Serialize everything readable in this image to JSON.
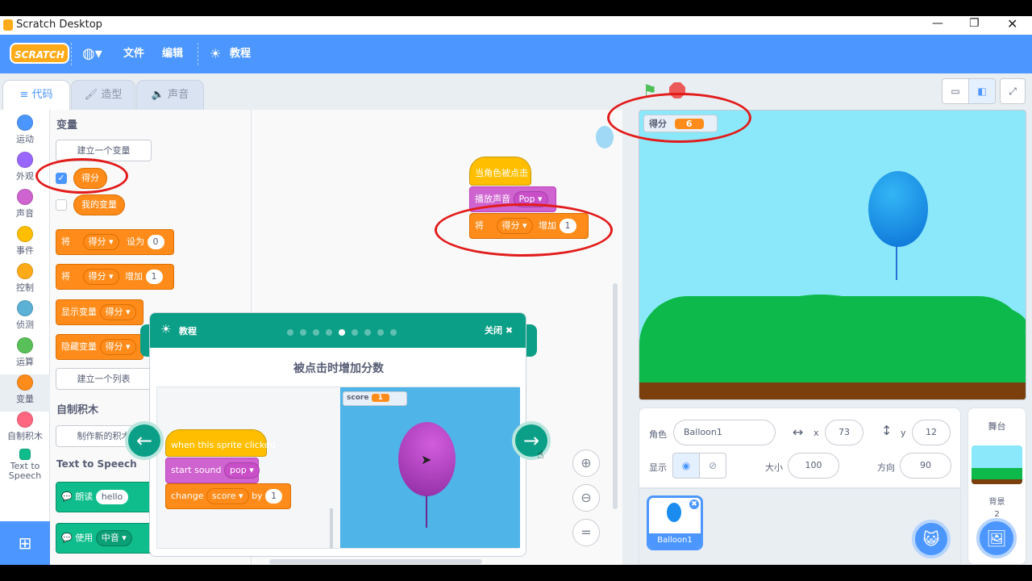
{
  "window": {
    "title": "Scratch Desktop"
  },
  "menubar": {
    "logo": "SCRATCH",
    "file": "文件",
    "edit": "编辑",
    "tutorials": "教程"
  },
  "tabs": {
    "code": "代码",
    "costumes": "造型",
    "sounds": "声音"
  },
  "categories": [
    {
      "label": "运动",
      "color": "#4c97ff"
    },
    {
      "label": "外观",
      "color": "#9966ff"
    },
    {
      "label": "声音",
      "color": "#cf63cf"
    },
    {
      "label": "事件",
      "color": "#ffbf00"
    },
    {
      "label": "控制",
      "color": "#ffab19"
    },
    {
      "label": "侦测",
      "color": "#5cb1d6"
    },
    {
      "label": "运算",
      "color": "#59c059"
    },
    {
      "label": "变量",
      "color": "#ff8c1a"
    },
    {
      "label": "自制积木",
      "color": "#ff6680"
    },
    {
      "label": "Text to Speech",
      "color": "#0fbd8c"
    }
  ],
  "palette": {
    "variables_heading": "变量",
    "make_variable": "建立一个变量",
    "var_score": "得分",
    "var_mine": "我的变量",
    "set_block": {
      "prefix": "将",
      "var": "得分",
      "mid": "设为",
      "value": "0"
    },
    "change_block": {
      "prefix": "将",
      "var": "得分",
      "mid": "增加",
      "value": "1"
    },
    "show_var": {
      "label": "显示变量",
      "var": "得分"
    },
    "hide_var": {
      "label": "隐藏变量",
      "var": "得分"
    },
    "make_list": "建立一个列表",
    "my_blocks_heading": "自制积木",
    "make_block": "制作新的积木",
    "tts_heading": "Text to Speech",
    "speak": {
      "label": "朗读",
      "value": "hello"
    },
    "use": {
      "label": "使用",
      "value": "中音"
    }
  },
  "script": {
    "hat": "当角色被点击",
    "sound": {
      "label": "播放声音",
      "value": "Pop"
    },
    "change": {
      "prefix": "将",
      "var": "得分",
      "mid": "增加",
      "value": "1"
    }
  },
  "tutorial": {
    "header": "教程",
    "close": "关闭",
    "title": "被点击时增加分数",
    "dots_total": 9,
    "dots_active": 5,
    "demo_hat": "when this sprite clicked",
    "demo_sound": {
      "label": "start sound",
      "value": "pop"
    },
    "demo_change": {
      "prefix": "change",
      "var": "score",
      "mid": "by",
      "value": "1"
    },
    "demo_monitor": {
      "label": "score",
      "value": "1"
    }
  },
  "stage": {
    "monitor_label": "得分",
    "monitor_value": "6"
  },
  "sprite_info": {
    "sprite_label": "角色",
    "sprite_name": "Balloon1",
    "x_label": "x",
    "x": "73",
    "y_label": "y",
    "y": "12",
    "show_label": "显示",
    "size_label": "大小",
    "size": "100",
    "direction_label": "方向",
    "direction": "90"
  },
  "sprite_list": [
    {
      "name": "Balloon1"
    }
  ],
  "stage_panel": {
    "title": "舞台",
    "backdrops_label": "背景",
    "backdrops_count": "2"
  },
  "colors": {
    "accent": "#4c97ff",
    "variables": "#ff8c1a",
    "tutorial": "#0b9f87",
    "highlight": "#e21b1b"
  }
}
